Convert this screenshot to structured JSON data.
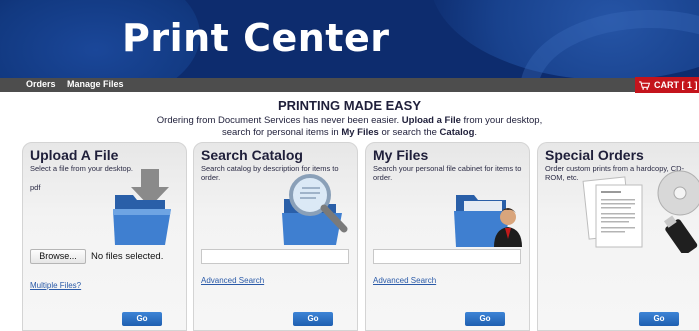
{
  "banner": {
    "title": "Print Center"
  },
  "nav": {
    "orders": "Orders",
    "manage_files": "Manage Files",
    "cart": "CART [ 1 ]"
  },
  "intro": {
    "headline": "PRINTING MADE EASY",
    "line1_a": "Ordering from Document Services has never been easier. ",
    "line1_b": "Upload a File",
    "line1_c": " from your desktop,",
    "line2_a": "search for personal items in ",
    "line2_b": "My Files",
    "line2_c": " or search the ",
    "line2_d": "Catalog",
    "line2_e": "."
  },
  "panels": {
    "upload": {
      "title": "Upload A File",
      "desc": "Select a file from your desktop.",
      "file_type": "pdf",
      "browse_label": "Browse...",
      "file_status": "No files selected.",
      "multi_link": "Multiple Files?",
      "go_label": "Go"
    },
    "catalog": {
      "title": "Search Catalog",
      "desc": "Search catalog by description for items to order.",
      "search_value": "",
      "advanced_link": "Advanced Search",
      "go_label": "Go"
    },
    "myfiles": {
      "title": "My Files",
      "desc": "Search your personal file cabinet for items to order.",
      "search_value": "",
      "advanced_link": "Advanced Search",
      "go_label": "Go"
    },
    "special": {
      "title": "Special Orders",
      "desc": "Order custom prints from a hardcopy, CD-ROM, etc.",
      "go_label": "Go"
    }
  },
  "colors": {
    "banner": "#0d2c6e",
    "navbar": "#4d4d4d",
    "cart": "#c4141c",
    "button": "#2a6cc2",
    "link": "#2a5aa8"
  },
  "icons": [
    "cart-icon",
    "folder-download-icon",
    "folder-magnifier-icon",
    "folder-user-icon",
    "documents-cd-usb-icon"
  ]
}
